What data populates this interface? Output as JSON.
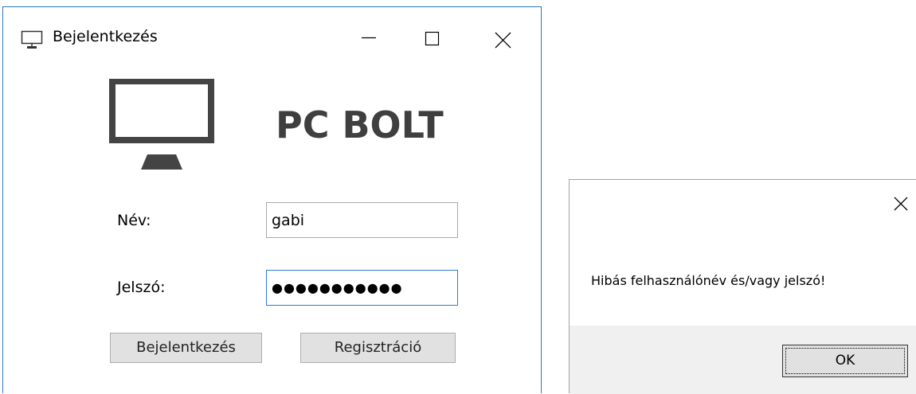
{
  "login_window": {
    "title": "Bejelentkezés",
    "icons": {
      "app": "monitor-icon",
      "minimize": "minimize-icon",
      "maximize": "maximize-icon",
      "close": "close-icon",
      "logo": "monitor-icon"
    },
    "brand": "PC BOLT",
    "name_label": "Név:",
    "name_value": "gabi",
    "password_label": "Jelszó:",
    "password_value": "●●●●●●●●●●●",
    "login_button": "Bejelentkezés",
    "register_button": "Regisztráció",
    "border_color": "#2b78c5"
  },
  "message_dialog": {
    "close_icon": "close-icon",
    "message": "Hibás felhasználónév és/vagy jelszó!",
    "ok_button": "OK"
  }
}
